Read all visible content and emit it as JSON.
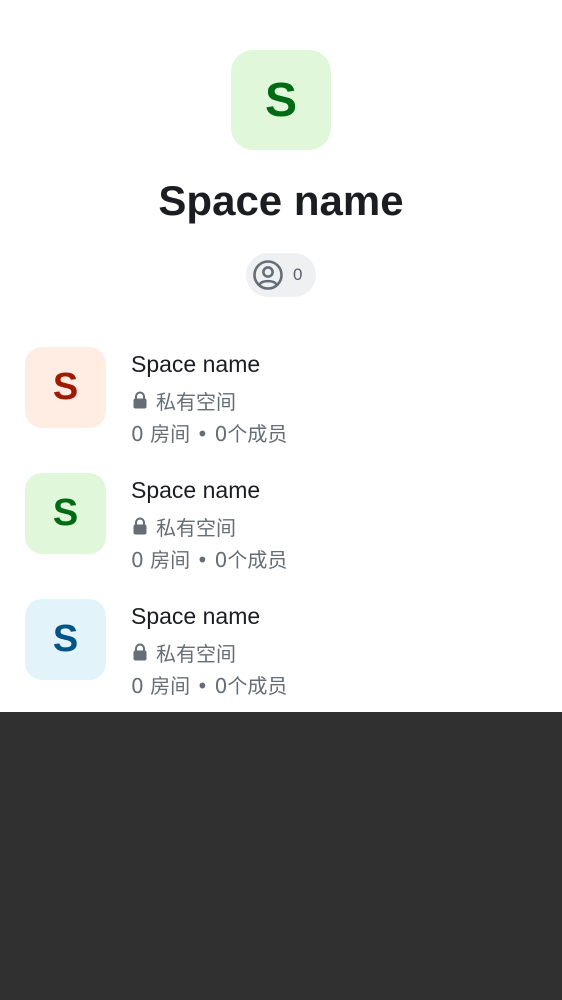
{
  "space": {
    "avatar_letter": "S",
    "avatar_bg": "#e0f8d9",
    "avatar_fg": "#006b14",
    "title": "Space name",
    "members_icon": "user-circle-icon",
    "member_count": "0"
  },
  "rooms": [
    {
      "avatar_letter": "S",
      "avatar_bg": "#ffede4",
      "avatar_fg": "#9e1a00",
      "name": "Space name",
      "privacy_icon": "lock-icon",
      "privacy": "私有空间",
      "stats": "0 房间 • 0个成员"
    },
    {
      "avatar_letter": "S",
      "avatar_bg": "#e0f8d9",
      "avatar_fg": "#006b14",
      "name": "Space name",
      "privacy_icon": "lock-icon",
      "privacy": "私有空间",
      "stats": "0 房间 • 0个成员"
    },
    {
      "avatar_letter": "S",
      "avatar_bg": "#e2f4fa",
      "avatar_fg": "#005486",
      "name": "Space name",
      "privacy_icon": "lock-icon",
      "privacy": "私有空间",
      "stats": "0 房间 • 0个成员"
    }
  ],
  "colors": {
    "text_primary": "#1b1d22",
    "text_secondary": "#656d77",
    "chip_bg": "#eff0f2",
    "bottom_area": "#303030"
  }
}
